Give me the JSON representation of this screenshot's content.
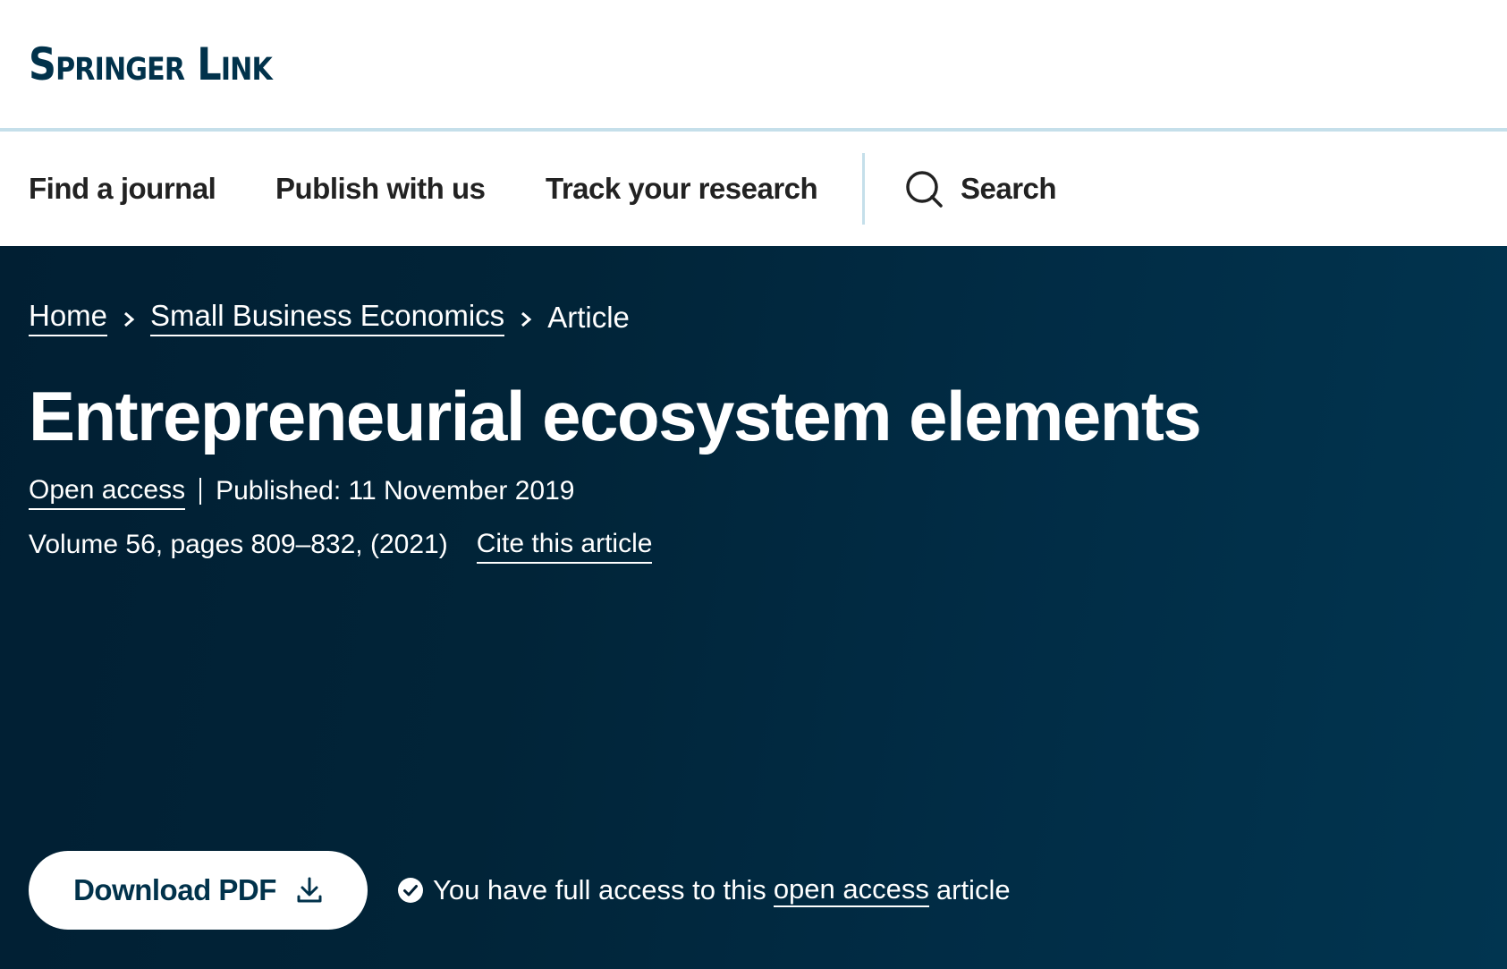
{
  "header": {
    "logo_text": "Springer Link"
  },
  "nav": {
    "items": [
      {
        "label": "Find a journal"
      },
      {
        "label": "Publish with us"
      },
      {
        "label": "Track your research"
      }
    ],
    "search_label": "Search",
    "search_icon": "search-icon"
  },
  "breadcrumb": {
    "items": [
      {
        "label": "Home",
        "link": true
      },
      {
        "label": "Small Business Economics",
        "link": true
      },
      {
        "label": "Article",
        "link": false
      }
    ],
    "separator_icon": "chevron-right-icon"
  },
  "article": {
    "title": "Entrepreneurial ecosystem elements",
    "access_label": "Open access",
    "published": "Published: 11 November 2019",
    "volume_pages": "Volume 56, pages 809–832, (2021)",
    "cite_label": "Cite this article"
  },
  "actions": {
    "download_label": "Download PDF",
    "download_icon": "download-icon",
    "access_note_prefix": "You have full access to this",
    "access_note_link": "open access",
    "access_note_suffix": "article",
    "check_icon": "check-circle-icon"
  },
  "colors": {
    "brand_navy": "#01324b",
    "header_rule": "#c5dfea",
    "hero_dark": "#011f33",
    "hero_light": "#013550",
    "nav_text": "#222222"
  }
}
